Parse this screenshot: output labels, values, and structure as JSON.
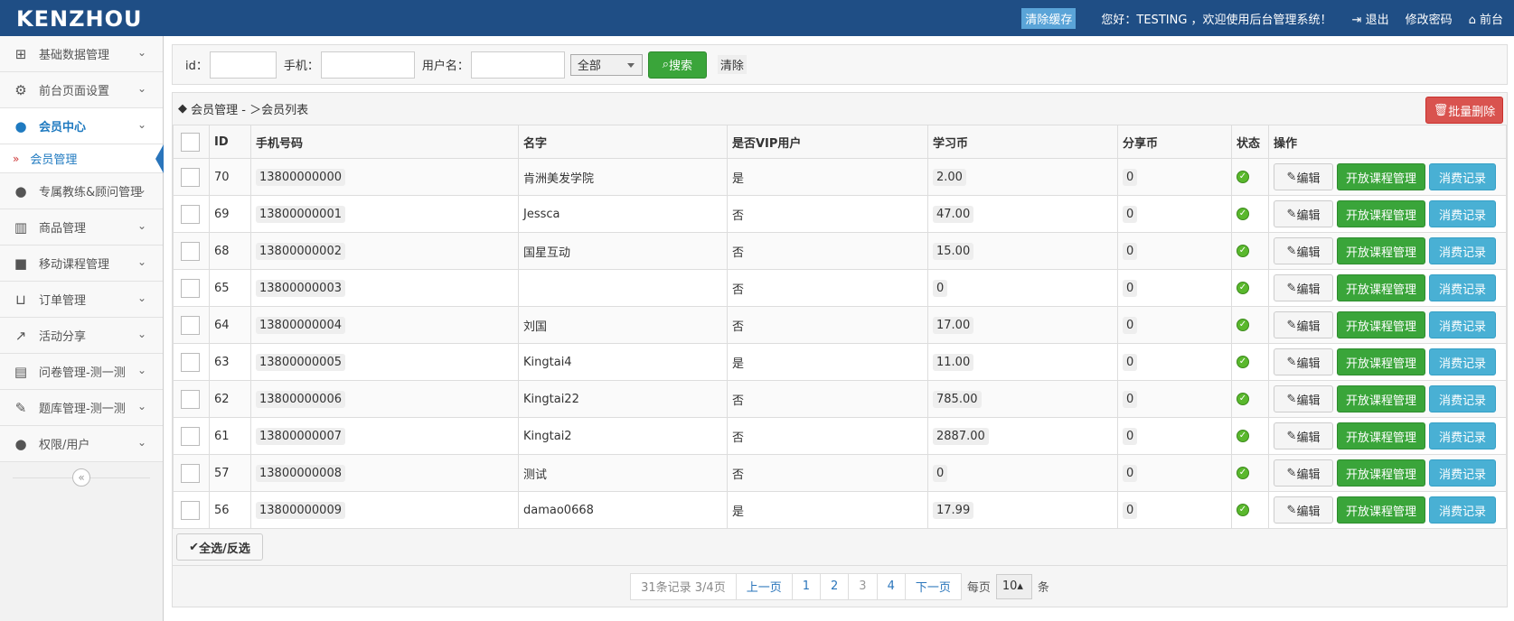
{
  "header": {
    "logo": "KENZHOU",
    "cache_btn": "清除缓存",
    "greeting": "您好：TESTING ，欢迎使用后台管理系统！",
    "logout": "退出",
    "change_password": "修改密码",
    "frontend": "前台"
  },
  "sidebar": {
    "items": [
      {
        "label": "基础数据管理",
        "icon": "sitemap-icon"
      },
      {
        "label": "前台页面设置",
        "icon": "gears-icon"
      },
      {
        "label": "会员中心",
        "icon": "user-icon"
      },
      {
        "label": "专属教练&顾问管理",
        "icon": "user-md-icon"
      },
      {
        "label": "商品管理",
        "icon": "barcode-icon"
      },
      {
        "label": "移动课程管理",
        "icon": "video-camera-icon"
      },
      {
        "label": "订单管理",
        "icon": "cart-icon"
      },
      {
        "label": "活动分享",
        "icon": "share-icon"
      },
      {
        "label": "问卷管理-测一测",
        "icon": "book-icon"
      },
      {
        "label": "题库管理-测一测",
        "icon": "pencil-icon"
      },
      {
        "label": "权限/用户",
        "icon": "user-icon"
      }
    ],
    "subitem": "会员管理"
  },
  "filter": {
    "id_label": "id：",
    "phone_label": "手机：",
    "username_label": "用户名：",
    "select_value": "全部",
    "search_btn": "搜索",
    "clear_btn": "清除"
  },
  "panel": {
    "breadcrumb": "会员管理  - ＞会员列表",
    "batch_delete": "批量删除",
    "columns": [
      "ID",
      "手机号码",
      "名字",
      "是否VIP用户",
      "学习币",
      "分享币",
      "状态",
      "操作"
    ],
    "rows": [
      {
        "id": "70",
        "phone": "13800000000",
        "name": "肯洲美发学院",
        "vip": "是",
        "coins": "2.00",
        "share": "0"
      },
      {
        "id": "69",
        "phone": "13800000001",
        "name": "Jessca",
        "vip": "否",
        "coins": "47.00",
        "share": "0"
      },
      {
        "id": "68",
        "phone": "13800000002",
        "name": "国星互动",
        "vip": "否",
        "coins": "15.00",
        "share": "0"
      },
      {
        "id": "65",
        "phone": "13800000003",
        "name": "",
        "vip": "否",
        "coins": "0",
        "share": "0"
      },
      {
        "id": "64",
        "phone": "13800000004",
        "name": "刘国",
        "vip": "否",
        "coins": "17.00",
        "share": "0"
      },
      {
        "id": "63",
        "phone": "13800000005",
        "name": "Kingtai4",
        "vip": "是",
        "coins": "11.00",
        "share": "0"
      },
      {
        "id": "62",
        "phone": "13800000006",
        "name": "Kingtai22",
        "vip": "否",
        "coins": "785.00",
        "share": "0"
      },
      {
        "id": "61",
        "phone": "13800000007",
        "name": "Kingtai2",
        "vip": "否",
        "coins": "2887.00",
        "share": "0"
      },
      {
        "id": "57",
        "phone": "13800000008",
        "name": "测试",
        "vip": "否",
        "coins": "0",
        "share": "0"
      },
      {
        "id": "56",
        "phone": "13800000009",
        "name": "damao0668",
        "vip": "是",
        "coins": "17.99",
        "share": "0"
      }
    ],
    "edit_btn": "编辑",
    "course_btn": "开放课程管理",
    "record_btn": "消费记录",
    "select_all": "全选/反选"
  },
  "pager": {
    "info": "31条记录 3/4页",
    "prev": "上一页",
    "pages": [
      "1",
      "2",
      "3",
      "4"
    ],
    "current_page": "3",
    "next": "下一页",
    "per_page_label": "每页",
    "per_page_value": "10",
    "per_page_unit": "条"
  },
  "colors": {
    "header_bg": "#1f4e85",
    "success": "#3aa53a",
    "info": "#49b0d4",
    "danger": "#d9534f",
    "link": "#2a75bb"
  }
}
